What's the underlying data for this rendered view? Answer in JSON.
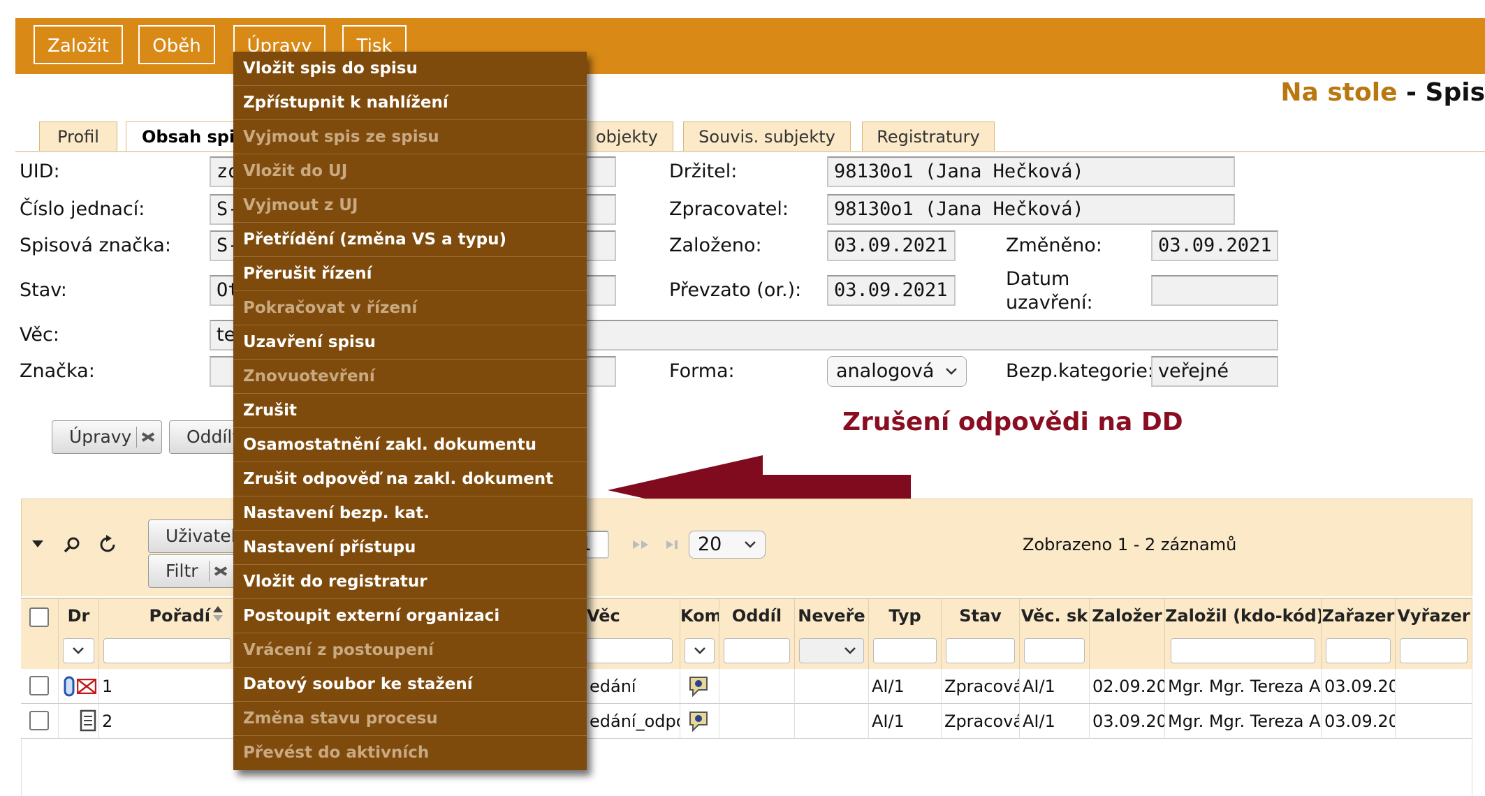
{
  "toolbar": {
    "buttons": [
      "Založit",
      "Oběh",
      "Úpravy",
      "Tisk"
    ]
  },
  "header": {
    "title_a": "Na stole",
    "title_sep": " - ",
    "title_b": "Spis"
  },
  "tabs": [
    "Profil",
    "Obsah spi",
    "objekty",
    "Souvis. subjekty",
    "Registratury"
  ],
  "form": {
    "uid_label": "UID:",
    "uid_value": "zo",
    "cj_label": "Číslo jednací:",
    "cj_value": "S-",
    "sz_label": "Spisová značka:",
    "sz_value": "S-",
    "stav_label": "Stav:",
    "stav_value": "Ot",
    "vec_label": "Věc:",
    "vec_value": "te",
    "znacka_label": "Značka:",
    "drzitel_label": "Držitel:",
    "drzitel_value": "98130o1 (Jana Hečková)",
    "zprac_label": "Zpracovatel:",
    "zprac_value": "98130o1 (Jana Hečková)",
    "zalozeno_label": "Založeno:",
    "zalozeno_value": "03.09.2021",
    "zmeneno_label": "Změněno:",
    "zmeneno_value": "03.09.2021",
    "prevzato_label": "Převzato (or.):",
    "prevzato_value": "03.09.2021",
    "datum_label_1": "Datum",
    "datum_label_2": "uzavření:",
    "forma_label": "Forma:",
    "forma_value": "analogová",
    "bezp_label": "Bezp.kategorie:",
    "bezp_value": "veřejné"
  },
  "actions": {
    "upravy": "Úpravy",
    "oddily": "Oddíly"
  },
  "annotation": {
    "title": "Zrušení odpovědi na DD",
    "arrow_color": "#800a1e"
  },
  "grid": {
    "user_btn": "Uživatels",
    "filter_btn": "Filtr",
    "page_value": "1",
    "page_size": "20",
    "count_text": "Zobrazeno 1 - 2 záznamů",
    "columns": [
      "Dr",
      "Pořadí",
      "Věc",
      "Kom",
      "Oddíl",
      "Neveře",
      "Typ",
      "Stav",
      "Věc. sk",
      "Založer",
      "Založil (kdo-kód)",
      "Zařazer",
      "Vyřazer"
    ],
    "rows": [
      {
        "poradi": "1",
        "vec": "edání",
        "typ": "AI/1",
        "stav": "Zpracová",
        "vecsk": "AI/1",
        "zalozen": "02.09.20",
        "zalozil": "Mgr. Mgr. Tereza A",
        "zarazen": "03.09.20"
      },
      {
        "poradi": "2",
        "vec": "edání_odpo",
        "typ": "AI/1",
        "stav": "Zpracová",
        "vecsk": "AI/1",
        "zalozen": "03.09.20",
        "zalozil": "Mgr. Mgr. Tereza A",
        "zarazen": "03.09.20"
      }
    ]
  },
  "menu": [
    {
      "label": "Vložit spis do spisu",
      "enabled": true
    },
    {
      "label": "Zpřístupnit k nahlížení",
      "enabled": true
    },
    {
      "label": "Vyjmout spis ze spisu",
      "enabled": false
    },
    {
      "label": "Vložit do UJ",
      "enabled": false
    },
    {
      "label": "Vyjmout z UJ",
      "enabled": false
    },
    {
      "label": "Přetřídění (změna VS a typu)",
      "enabled": true
    },
    {
      "label": "Přerušit řízení",
      "enabled": true
    },
    {
      "label": "Pokračovat v řízení",
      "enabled": false
    },
    {
      "label": "Uzavření spisu",
      "enabled": true
    },
    {
      "label": "Znovuotevření",
      "enabled": false
    },
    {
      "label": "Zrušit",
      "enabled": true
    },
    {
      "label": "Osamostatnění zakl. dokumentu",
      "enabled": true
    },
    {
      "label": "Zrušit odpověď na zakl. dokument",
      "enabled": true
    },
    {
      "label": "Nastavení bezp. kat.",
      "enabled": true
    },
    {
      "label": "Nastavení přístupu",
      "enabled": true
    },
    {
      "label": "Vložit do registratur",
      "enabled": true
    },
    {
      "label": "Postoupit externí organizaci",
      "enabled": true
    },
    {
      "label": "Vrácení z postoupení",
      "enabled": false
    },
    {
      "label": "Datový soubor ke stažení",
      "enabled": true
    },
    {
      "label": "Změna stavu procesu",
      "enabled": false
    },
    {
      "label": "Převést do aktivních",
      "enabled": false
    }
  ]
}
